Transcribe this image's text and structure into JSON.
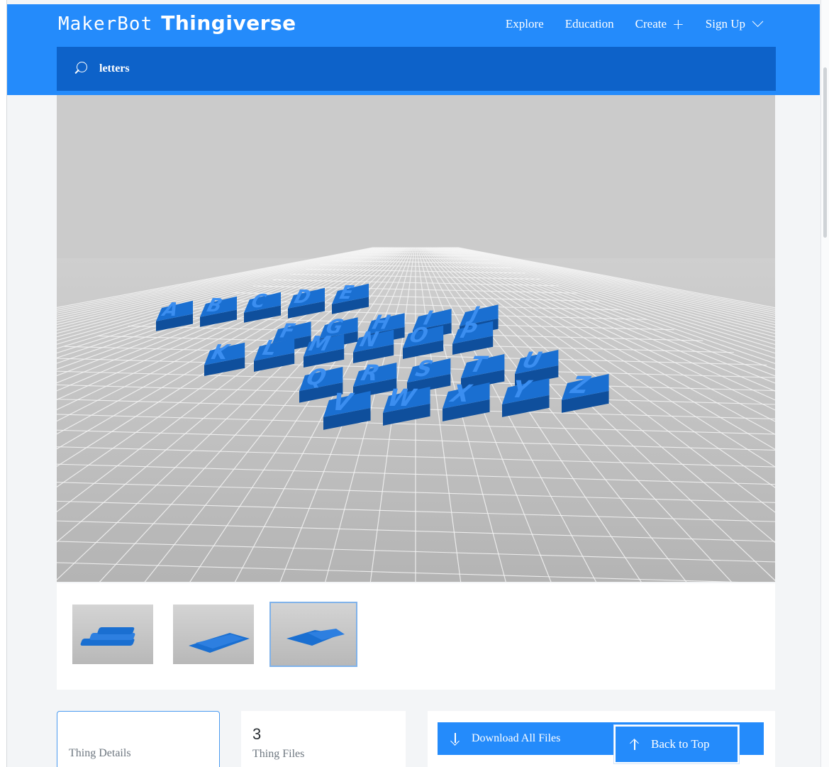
{
  "header": {
    "logo_left": "MakerBot",
    "logo_right": "Thingiverse",
    "nav": {
      "explore": "Explore",
      "education": "Education",
      "create": "Create",
      "signup": "Sign Up"
    }
  },
  "search": {
    "value": "letters"
  },
  "viewer": {
    "letter_color": "#1a6fd1",
    "letters": [
      "A",
      "B",
      "C",
      "D",
      "E",
      "F",
      "G",
      "H",
      "I",
      "J",
      "K",
      "L",
      "M",
      "N",
      "O",
      "P",
      "Q",
      "R",
      "S",
      "T",
      "U",
      "V",
      "W",
      "X",
      "Y",
      "Z"
    ]
  },
  "thumbnails": {
    "count": 3,
    "selected_index": 2
  },
  "cards": {
    "details_label": "Thing Details",
    "files_count": "3",
    "files_label": "Thing Files",
    "download_label": "Download All Files"
  },
  "back_to_top": "Back to Top",
  "colors": {
    "brand_blue": "#248bfb",
    "search_blue": "#0d62c9"
  }
}
